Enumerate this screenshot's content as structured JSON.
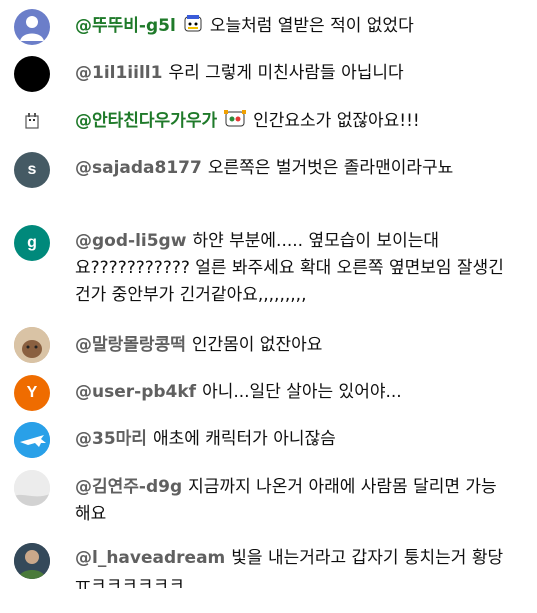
{
  "comments": [
    {
      "author": "@뚜뚜비-g5l",
      "text": "오늘처럼 열받은 적이 없었다",
      "avatar_icon": "default-user-icon",
      "name_color": "#1f7a2a"
    },
    {
      "author": "@1il1iill1",
      "text": "우리 그렇게 미친사람들 아닙니다",
      "avatar_icon": "black-circle"
    },
    {
      "author": "@안타친다우가우가",
      "text": "인간요소가 없잖아요!!!",
      "avatar_icon": "pixel-avatar",
      "name_color": "#1f7a2a"
    },
    {
      "author": "@sajada8177",
      "text": "오른쪽은 벌거벗은 졸라맨이라구뇨",
      "avatar_letter": "s",
      "avatar_color": "#455a64"
    },
    {
      "author": "@god-li5gw",
      "text": "하얀 부분에..... 옆모습이 보이는대요??????????? 얼른 봐주세요 확대 오른쪽 옆면보임 잘생긴건가 중안부가 긴거같아요,,,,,,,,,",
      "avatar_letter": "g",
      "avatar_color": "#00897b"
    },
    {
      "author": "@말랑몰랑콩떡",
      "text": "인간몸이 없잔아요",
      "avatar_icon": "photo-avatar"
    },
    {
      "author": "@user-pb4kf",
      "text": "아니...일단 살아는 있어야...",
      "avatar_letter": "Y",
      "avatar_color": "#ef6c00"
    },
    {
      "author": "@35마리",
      "text": "애초에 캐릭터가 아니잖슴",
      "avatar_icon": "airplane-icon"
    },
    {
      "author": "@김연주-d9g",
      "text": "지금까지 나온거 아래에 사람몸 달리면 가능해요",
      "avatar_icon": "photo-avatar"
    },
    {
      "author": "@l_haveadream",
      "text": "빛을 내는거라고 갑자기 퉁치는거 황당 ㅠㅋㅋㅋㅋㅋㅋ",
      "avatar_icon": "photo-avatar"
    }
  ]
}
